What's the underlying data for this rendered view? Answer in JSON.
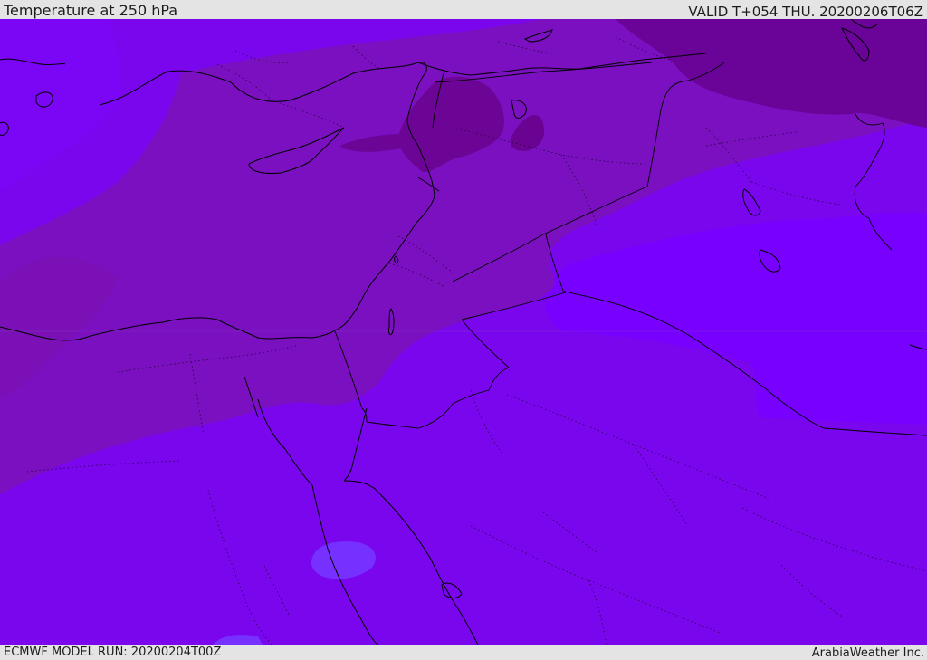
{
  "header": {
    "title": "Temperature at 250 hPa",
    "valid_time": "VALID T+054 THU. 20200206T06Z"
  },
  "footer": {
    "model_run": "ECMWF MODEL RUN: 20200204T00Z",
    "provider": "ArabiaWeather Inc."
  },
  "colors": {
    "band_cold_light": "#7800ff",
    "band_cold_mid": "#7b0bd8",
    "band_cold_deep": "#7a11b8",
    "band_coldest": "#6c049c",
    "band_bright_patch": "#7630ff",
    "border_lines": "#000000"
  }
}
